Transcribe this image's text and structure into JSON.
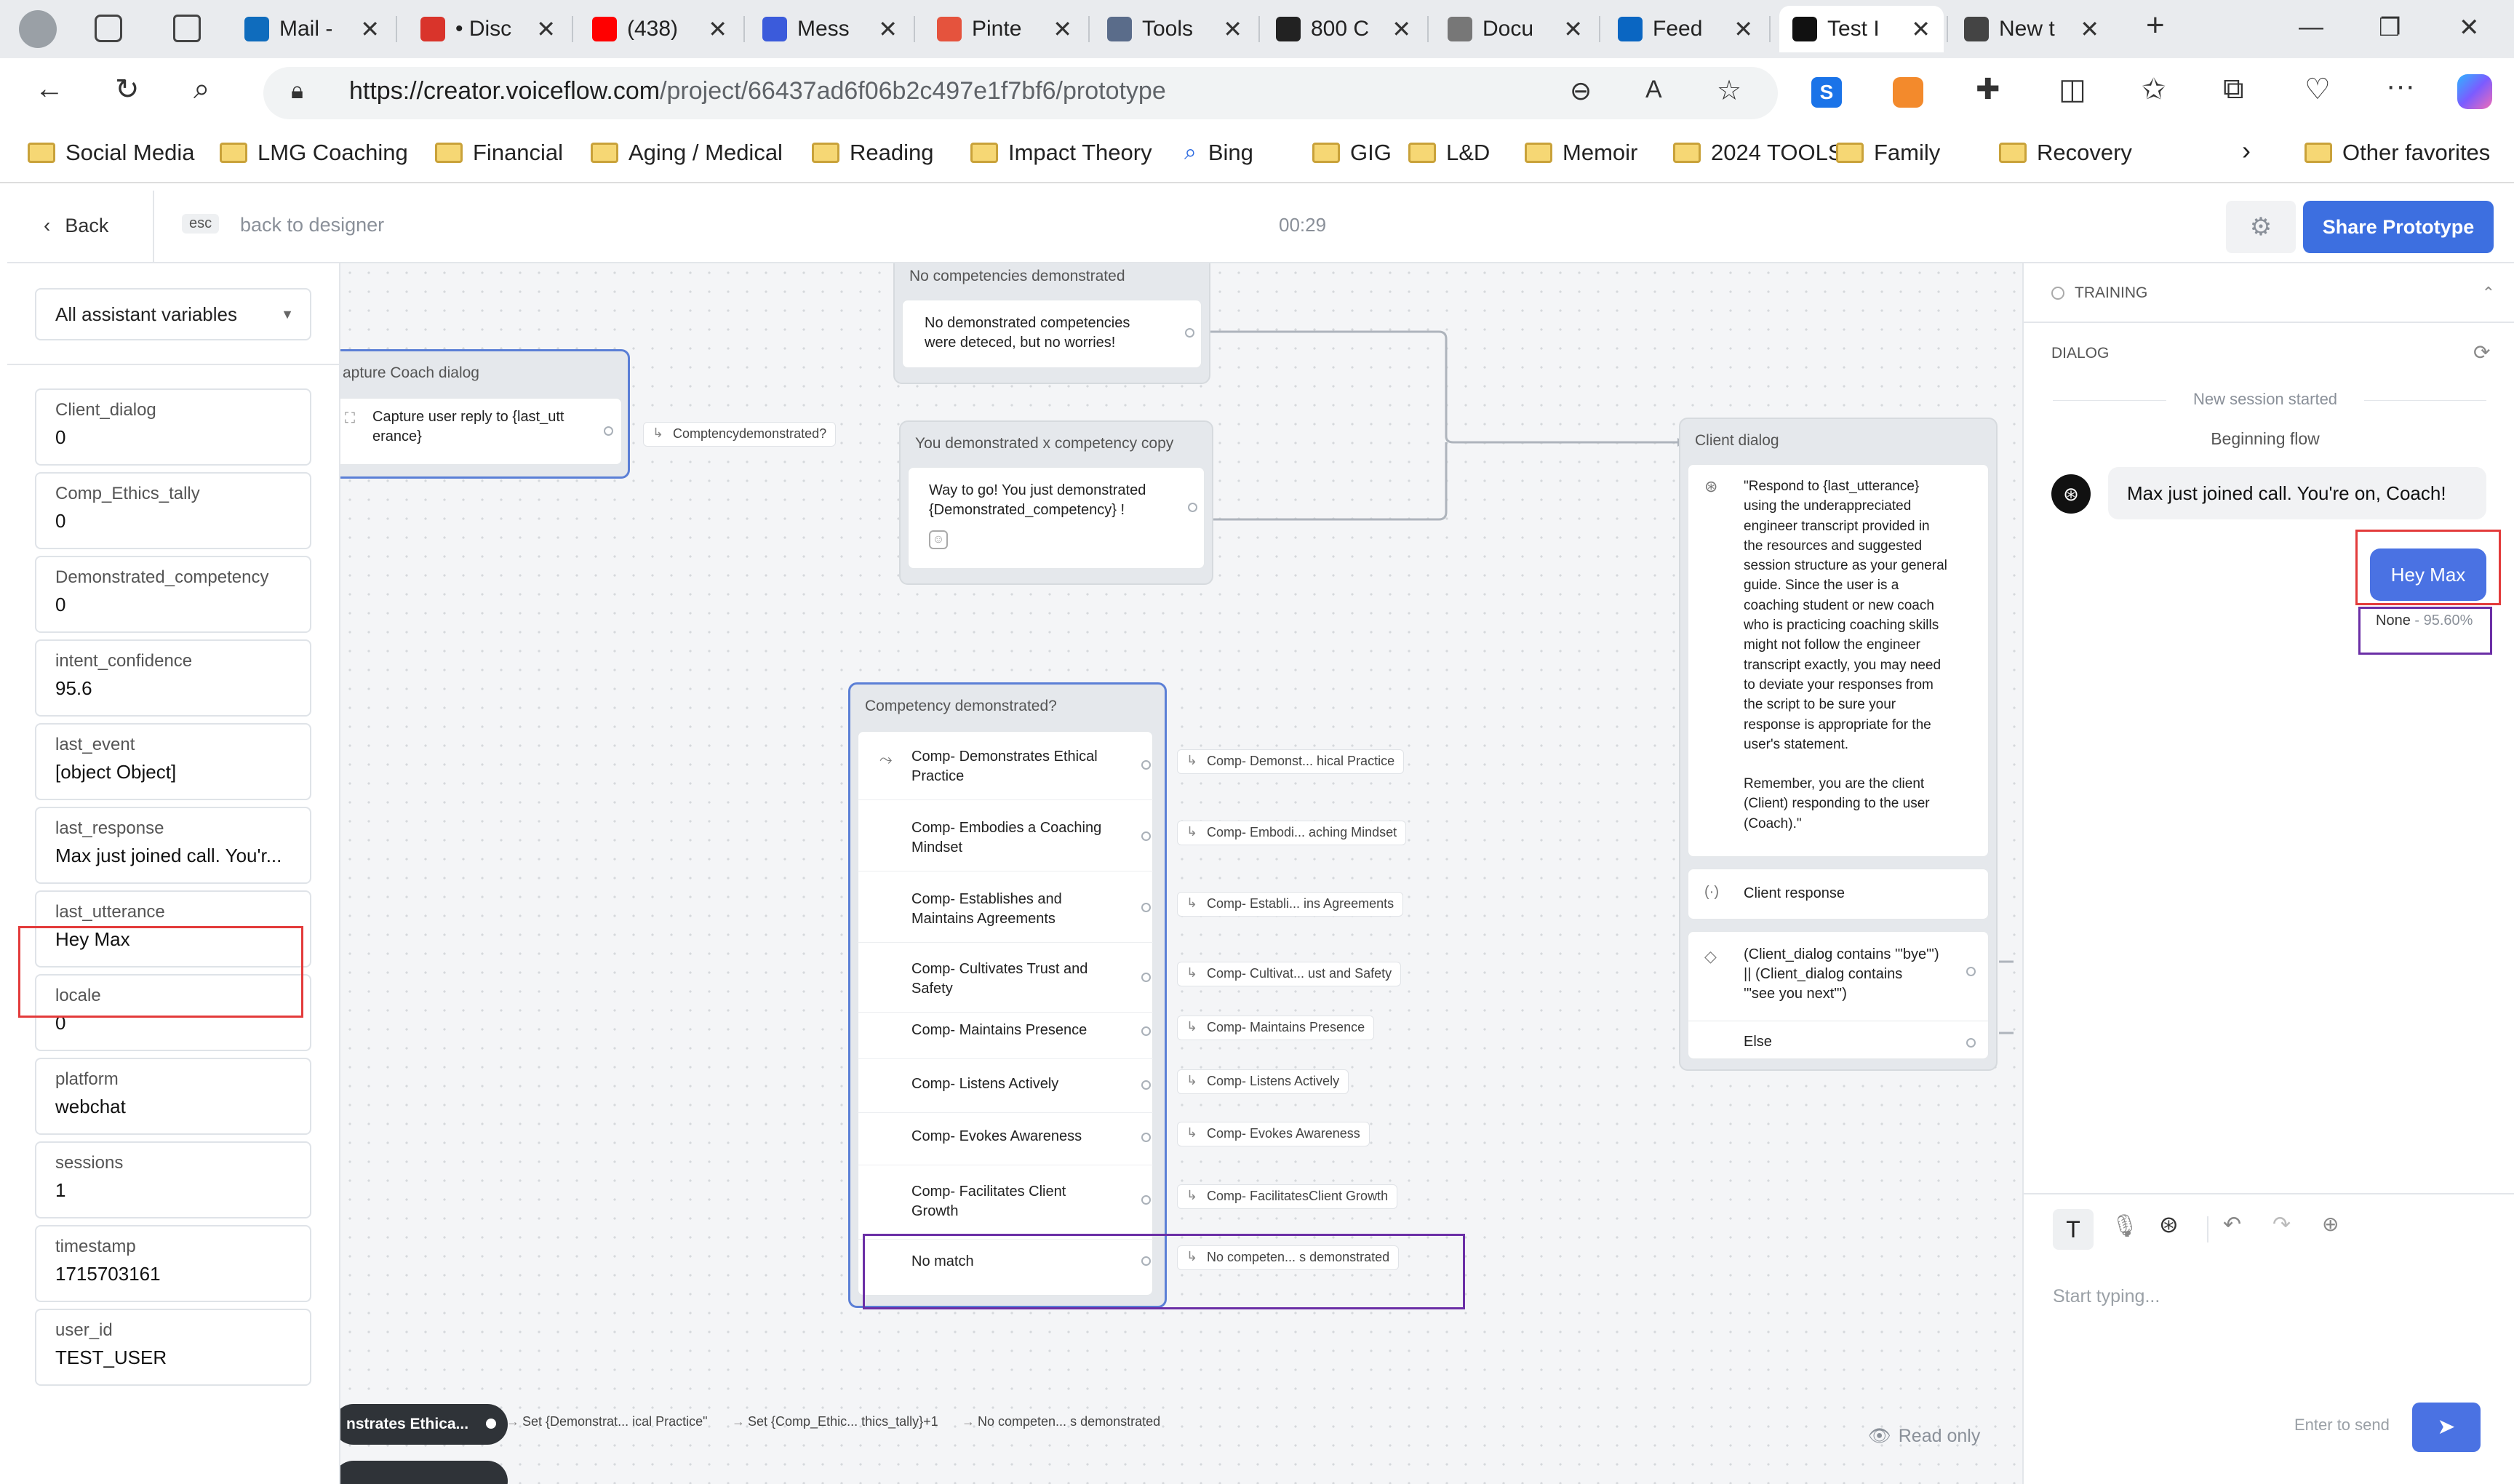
{
  "browser": {
    "tabs": [
      {
        "label": "Mail -",
        "icon": "outlook-icon",
        "color": "#0f6cbd"
      },
      {
        "label": "• Disc",
        "icon": "discord-icon",
        "color": "#d9342b"
      },
      {
        "label": "(438)",
        "icon": "youtube-icon",
        "color": "#ff0000"
      },
      {
        "label": "Mess",
        "icon": "messenger-icon",
        "color": "#3b5bdb"
      },
      {
        "label": "Pinte",
        "icon": "pdf-icon",
        "color": "#e5533d"
      },
      {
        "label": "Tools",
        "icon": "video-icon",
        "color": "#5a6c8a"
      },
      {
        "label": "800 C",
        "icon": "chatgpt-icon",
        "color": "#222222"
      },
      {
        "label": "Docu",
        "icon": "document-icon",
        "color": "#777777"
      },
      {
        "label": "Feed",
        "icon": "linkedin-icon",
        "color": "#0a66c2"
      },
      {
        "label": "Test I",
        "icon": "voiceflow-icon",
        "color": "#111111"
      },
      {
        "label": "New t",
        "icon": "newtab-icon",
        "color": "#444444"
      }
    ],
    "url_host": "https://creator.voiceflow.com",
    "url_path": "/project/66437ad6f06b2c497e1f7bf6/prototype",
    "bookmarks": [
      "Social Media",
      "LMG Coaching",
      "Financial",
      "Aging / Medical",
      "Reading",
      "Impact Theory",
      "Bing",
      "GIG",
      "L&D",
      "Memoir",
      "2024 TOOLS",
      "Family",
      "Recovery"
    ],
    "other_favorites": "Other favorites"
  },
  "app": {
    "back_label": "Back",
    "esc_key": "esc",
    "back_to_designer": "back to designer",
    "timer": "00:29",
    "share_label": "Share Prototype"
  },
  "variables": {
    "filter": "All assistant variables",
    "items": [
      {
        "name": "Client_dialog",
        "value": "0"
      },
      {
        "name": "Comp_Ethics_tally",
        "value": "0"
      },
      {
        "name": "Demonstrated_competency",
        "value": "0"
      },
      {
        "name": "intent_confidence",
        "value": "95.6"
      },
      {
        "name": "last_event",
        "value": "[object Object]"
      },
      {
        "name": "last_response",
        "value": "Max just joined call. You'r..."
      },
      {
        "name": "last_utterance",
        "value": "Hey Max"
      },
      {
        "name": "locale",
        "value": "0"
      },
      {
        "name": "platform",
        "value": "webchat"
      },
      {
        "name": "sessions",
        "value": "1"
      },
      {
        "name": "timestamp",
        "value": "1715703161"
      },
      {
        "name": "user_id",
        "value": "TEST_USER"
      }
    ]
  },
  "canvas": {
    "capture_block": {
      "title": "apture Coach dialog",
      "step": "Capture user reply to {last_utterance}",
      "step_l1": "Capture user reply to {last_utt",
      "step_l2": "erance}",
      "out": "Comptencydemonstrated?"
    },
    "no_comp_block": {
      "title": "No competencies demonstrated",
      "l1": "No demonstrated competencies",
      "l2": "were deteced, but no worries!"
    },
    "you_block": {
      "title": "You demonstrated x competency copy",
      "l1": "Way to go! You just demonstrated",
      "l2": "{Demonstrated_competency} !"
    },
    "choice_block": {
      "title": "Competency demonstrated?",
      "items": [
        {
          "l1": "Comp- Demonstrates Ethical",
          "l2": "Practice",
          "out": "Comp- Demonst... hical Practice"
        },
        {
          "l1": "Comp- Embodies a Coaching",
          "l2": "Mindset",
          "out": "Comp- Embodi... aching Mindset"
        },
        {
          "l1": "Comp- Establishes and",
          "l2": "Maintains Agreements",
          "out": "Comp- Establi... ins Agreements"
        },
        {
          "l1": "Comp- Cultivates Trust and",
          "l2": "Safety",
          "out": "Comp- Cultivat... ust and Safety"
        },
        {
          "l1": "Comp- Maintains Presence",
          "l2": "",
          "out": "Comp- Maintains Presence"
        },
        {
          "l1": "Comp- Listens Actively",
          "l2": "",
          "out": "Comp- Listens Actively"
        },
        {
          "l1": "Comp- Evokes Awareness",
          "l2": "",
          "out": "Comp- Evokes Awareness"
        },
        {
          "l1": "Comp- Facilitates Client",
          "l2": "Growth",
          "out": "Comp- FacilitatesClient Growth"
        }
      ],
      "no_match": "No match",
      "no_match_out": "No competen... s demonstrated"
    },
    "client_block": {
      "title": "Client dialog",
      "prompt_lines": [
        "\"Respond to {last_utterance}",
        "using the underappreciated",
        "engineer transcript provided in",
        "the resources and suggested",
        "session structure as your general",
        "guide. Since the user is a",
        "coaching student or new coach",
        "who is practicing coaching skills",
        "might not follow the engineer",
        "transcript exactly, you may need",
        "to deviate your responses from",
        "the script to be sure your",
        "response is appropriate for the",
        "user's statement.",
        "",
        "Remember, you are the client",
        "(Client) responding to the user",
        "(Coach).\""
      ],
      "capture": "Client response",
      "cond_lines": [
        "(Client_dialog contains '\"bye\"')",
        "|| (Client_dialog contains",
        "'\"see you next\"')"
      ],
      "else": "Else"
    },
    "bottom_pill": "nstrates Ethica...",
    "bottom_chain": [
      "Set {Demonstrat... ical Practice\"",
      "Set {Comp_Ethic... thics_tally}+1",
      "No competen... s demonstrated"
    ],
    "read_only": "Read only"
  },
  "chat": {
    "training": "TRAINING",
    "dialog": "DIALOG",
    "session_started": "New session started",
    "beginning_flow": "Beginning flow",
    "bot_message": "Max just joined call. You're on, Coach!",
    "user_message": "Hey Max",
    "intent_name": "None",
    "intent_conf": " - 95.60%",
    "input_placeholder": "Start typing...",
    "enter_hint": "Enter to send"
  }
}
